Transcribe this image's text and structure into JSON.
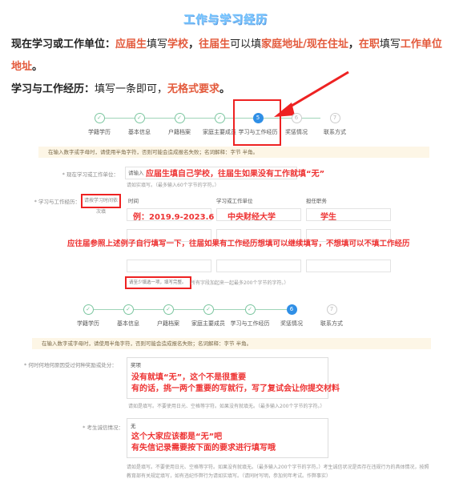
{
  "page_title": "工作与学习经历",
  "intro": {
    "line1_label": "现在学习或工作单位：",
    "line1_a": "应届生",
    "line1_b": "填写",
    "line1_c": "学校",
    "line1_d": "，",
    "line1_e": "往届生",
    "line1_f": "可以填",
    "line1_g": "家庭地址/现在住址",
    "line1_h": "，",
    "line1_i": "在职",
    "line1_j": "填写",
    "line1_k": "工作单位",
    "line2": "地址",
    "line2_end": "。",
    "line3_label": "学习与工作经历：",
    "line3_a": "填写一条即可，",
    "line3_b": "无格式要求",
    "line3_c": "。"
  },
  "steps_top": {
    "items": [
      {
        "num": "✓",
        "label": "学籍学历"
      },
      {
        "num": "✓",
        "label": "基本信息"
      },
      {
        "num": "✓",
        "label": "户籍档案"
      },
      {
        "num": "✓",
        "label": "家庭主要成员"
      },
      {
        "num": "5",
        "label": "学习与工作经历"
      },
      {
        "num": "6",
        "label": "奖惩情况"
      },
      {
        "num": "7",
        "label": "联系方式"
      }
    ]
  },
  "steps_bottom": {
    "items": [
      {
        "num": "✓",
        "label": "学籍学历"
      },
      {
        "num": "✓",
        "label": "基本信息"
      },
      {
        "num": "✓",
        "label": "户籍档案"
      },
      {
        "num": "✓",
        "label": "家庭主要成员"
      },
      {
        "num": "✓",
        "label": "学习与工作经历"
      },
      {
        "num": "6",
        "label": "奖惩情况"
      },
      {
        "num": "7",
        "label": "联系方式"
      }
    ]
  },
  "notice1": "在输入数字或字母时，请使用半角字符，否则可能会造成报名失败；名词解释：字节 半角。",
  "notice2": "在输入数字或字母时，请使用半角字符，否则可能会造成报名失败；名词解释：字节 半角。",
  "form1": {
    "unit_label": "* 现在学习或工作单位：",
    "unit_value": "请输入",
    "unit_hint": "请如实填写。（最多输入60个字节的字符。）",
    "exp_label": "* 学习与工作经历：",
    "exp_tag": "请按学习时间依次填",
    "col_time": "时间",
    "col_unit": "学习或工作单位",
    "col_job": "担任职务",
    "exp_hint_box": "请至少填选一项，填写完整。",
    "exp_hint": "所有字段加起来一起最多200个字节的字符。）"
  },
  "annotations": {
    "unit": "应届生填自己学校，往届生如果没有工作就填“无”",
    "example_time": "例：2019.9-2023.6",
    "example_unit": "中央财经大学",
    "example_job": "学生",
    "guide": "应往届参照上述例子自行填写一下，往届如果有工作经历想填可以继续填写，不想填可以不填工作经历",
    "award1": "没有就填“无”，这个不是很重要",
    "award2": "有的话，挑一两个重要的写就行，写了复试会让你提交材料",
    "punish1": "这个大家应该都是“无”吧",
    "punish2": "有失信记录需要按下面的要求进行填写哦"
  },
  "form2": {
    "award_label": "* 何时何地何原因受过何种奖励或处分：",
    "award_value": "奖项",
    "award_hint": "请如是填写。不要使用日光、空格等字符。如果没有就填无。（最多输入200个字节的字符。）",
    "punish_label": "* 考生诚信情况：",
    "punish_value": "无",
    "punish_hint": "请如是填写。不要使用日光、空格等字符。如果没有就填无。（最多输入200个字节的字符。）考生诚信状况是否存在违规行为的具体情况，按照教育部有关规定填写，如有违纪作弊行为请如实填写。（请同时写明，参加何年考试。作弊事实）"
  },
  "colors": {
    "accent": "#e35a3c",
    "step_done": "#7cc6a0",
    "step_current": "#2f8fe6",
    "annotation_red": "#e22"
  }
}
